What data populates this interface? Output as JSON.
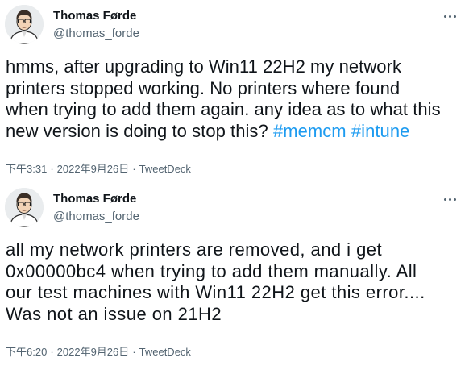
{
  "tweets": [
    {
      "author": {
        "name": "Thomas Førde",
        "handle": "@thomas_forde",
        "avatar_icon": "user-avatar"
      },
      "text_lines": [
        "hmms, after upgrading to Win11 22H2 my network",
        "printers stopped working. No printers where found",
        "when trying to add them again. any idea as to what this",
        "new version is doing to stop this? "
      ],
      "hashtags": [
        "#memcm",
        "#intune"
      ],
      "time": "下午3:31",
      "date": "2022年9月26日",
      "separator": "·",
      "source": "TweetDeck"
    },
    {
      "author": {
        "name": "Thomas Førde",
        "handle": "@thomas_forde",
        "avatar_icon": "user-avatar"
      },
      "text_lines": [
        "all my network printers are removed, and i get",
        "0x00000bc4 when trying to add them manually. All",
        "our test machines with Win11 22H2 get this error....",
        "Was not an issue on 21H2"
      ],
      "time": "下午6:20",
      "date": "2022年9月26日",
      "separator": "·",
      "source": "TweetDeck"
    }
  ],
  "colors": {
    "text": "#0f1419",
    "secondary": "#536471",
    "link": "#1d9bf0"
  }
}
